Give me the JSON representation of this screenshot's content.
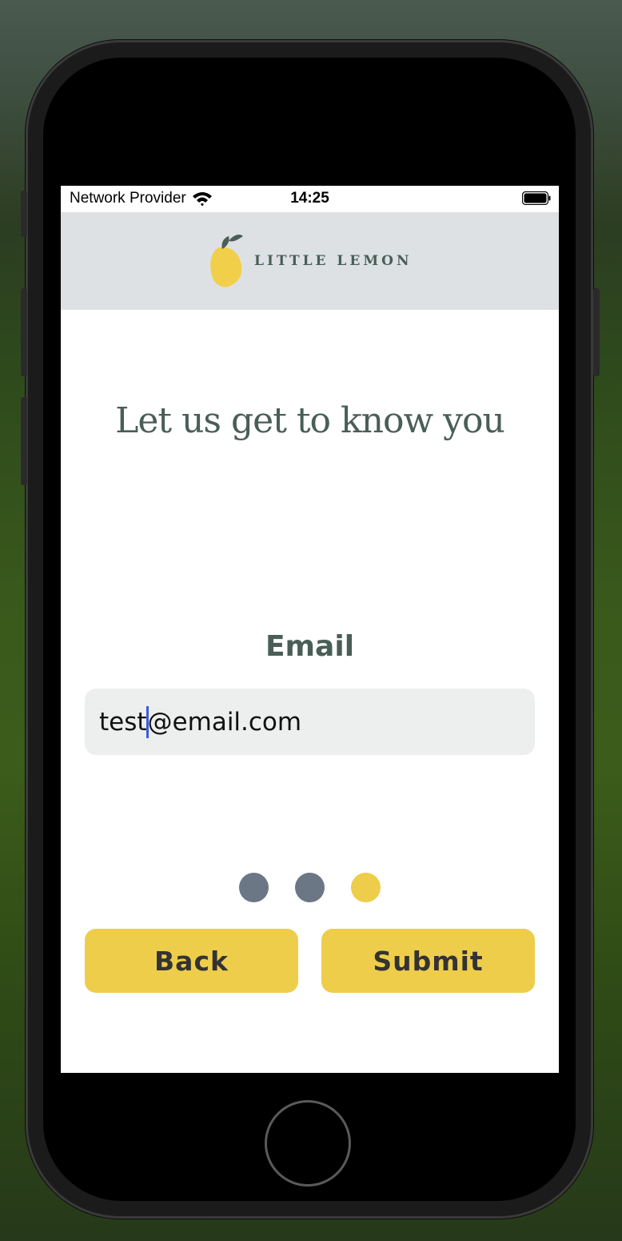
{
  "status_bar": {
    "carrier": "Network Provider",
    "time": "14:25",
    "wifi_icon": "wifi-icon",
    "battery_icon": "battery-icon"
  },
  "header": {
    "logo_icon": "lemon-icon",
    "logo_text": "LITTLE LEMON"
  },
  "main": {
    "heading": "Let us get to know you",
    "field_label": "Email",
    "email_value_before_caret": "test",
    "email_value_after_caret": "@email.com"
  },
  "pagination": {
    "total": 3,
    "active_index": 2,
    "inactive_color": "#6b7785",
    "active_color": "#eecd4a"
  },
  "actions": {
    "back_label": "Back",
    "submit_label": "Submit"
  },
  "colors": {
    "brand_green": "#495e57",
    "brand_yellow": "#eecd4a",
    "header_bg": "#dee1e4",
    "input_bg": "#edefee",
    "caret": "#3b5bdb"
  }
}
